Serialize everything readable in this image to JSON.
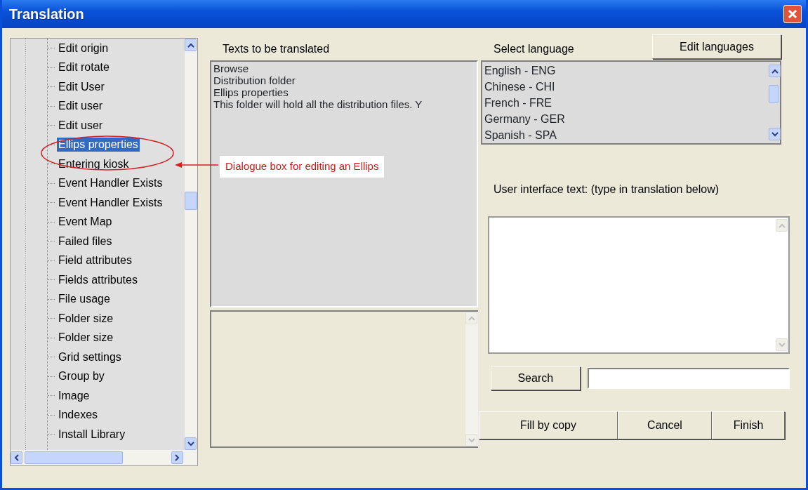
{
  "window": {
    "title": "Translation"
  },
  "tree": {
    "items": [
      {
        "label": "Edit origin",
        "selected": false
      },
      {
        "label": "Edit rotate",
        "selected": false
      },
      {
        "label": "Edit User",
        "selected": false
      },
      {
        "label": "Edit user",
        "selected": false
      },
      {
        "label": "Edit user",
        "selected": false
      },
      {
        "label": "Ellips properties",
        "selected": true
      },
      {
        "label": "Entering kiosk",
        "selected": false
      },
      {
        "label": "Event Handler Exists",
        "selected": false
      },
      {
        "label": "Event Handler Exists",
        "selected": false
      },
      {
        "label": "Event Map",
        "selected": false
      },
      {
        "label": "Failed files",
        "selected": false
      },
      {
        "label": "Field attributes",
        "selected": false
      },
      {
        "label": "Fields attributes",
        "selected": false
      },
      {
        "label": "File usage",
        "selected": false
      },
      {
        "label": "Folder size",
        "selected": false
      },
      {
        "label": "Folder size",
        "selected": false
      },
      {
        "label": "Grid settings",
        "selected": false
      },
      {
        "label": "Group by",
        "selected": false
      },
      {
        "label": "Image",
        "selected": false
      },
      {
        "label": "Indexes",
        "selected": false
      },
      {
        "label": "Install Library",
        "selected": false
      }
    ]
  },
  "texts": {
    "label": "Texts to be translated",
    "items": [
      "Browse",
      "Distribution folder",
      "Ellips properties",
      "This folder will hold all the distribution files. Y"
    ]
  },
  "languages": {
    "label": "Select language",
    "button": "Edit languages",
    "items": [
      "English - ENG",
      "Chinese - CHI",
      "French - FRE",
      "Germany - GER",
      "Spanish - SPA"
    ]
  },
  "ui_text": {
    "label": "User interface text: (type in translation below)"
  },
  "search": {
    "button": "Search"
  },
  "buttons": [
    "Fill by copy",
    "Cancel",
    "Finish"
  ],
  "annotation": {
    "text": "Dialogue box for editing an Ellips"
  }
}
